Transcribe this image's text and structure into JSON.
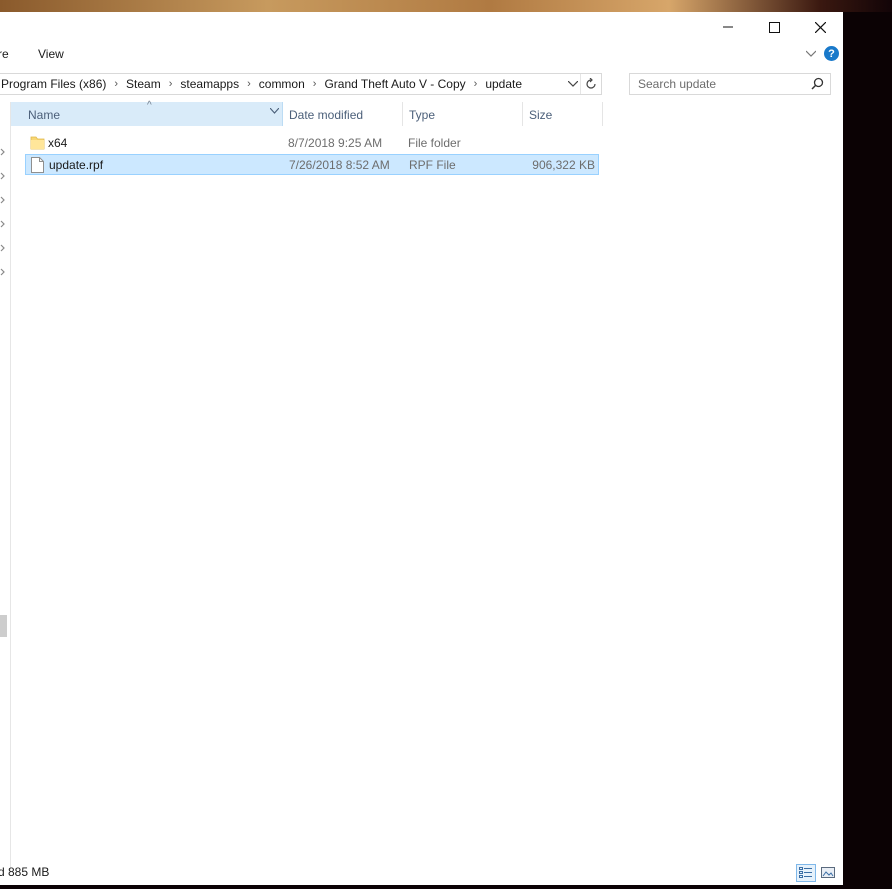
{
  "window": {
    "minimize_label": "Minimize",
    "maximize_label": "Maximize",
    "close_label": "Close"
  },
  "ribbon": {
    "tabs": [
      {
        "label": "re"
      },
      {
        "label": "View"
      }
    ],
    "help_label": "?"
  },
  "address": {
    "crumbs": [
      {
        "label": "Program Files (x86)"
      },
      {
        "label": "Steam"
      },
      {
        "label": "steamapps"
      },
      {
        "label": "common"
      },
      {
        "label": "Grand Theft Auto V - Copy"
      },
      {
        "label": "update"
      }
    ]
  },
  "search": {
    "placeholder": "Search update",
    "value": ""
  },
  "columns": {
    "name": "Name",
    "date": "Date modified",
    "type": "Type",
    "size": "Size"
  },
  "files": [
    {
      "name": "x64",
      "date": "8/7/2018 9:25 AM",
      "type": "File folder",
      "size": "",
      "icon": "folder-icon",
      "selected": false
    },
    {
      "name": "update.rpf",
      "date": "7/26/2018 8:52 AM",
      "type": "RPF File",
      "size": "906,322 KB",
      "icon": "file-icon",
      "selected": true
    }
  ],
  "status": {
    "text": "d 885 MB"
  },
  "colors": {
    "selection_bg": "#cce8ff",
    "selection_border": "#99d1ff",
    "accent": "#1979ca"
  }
}
